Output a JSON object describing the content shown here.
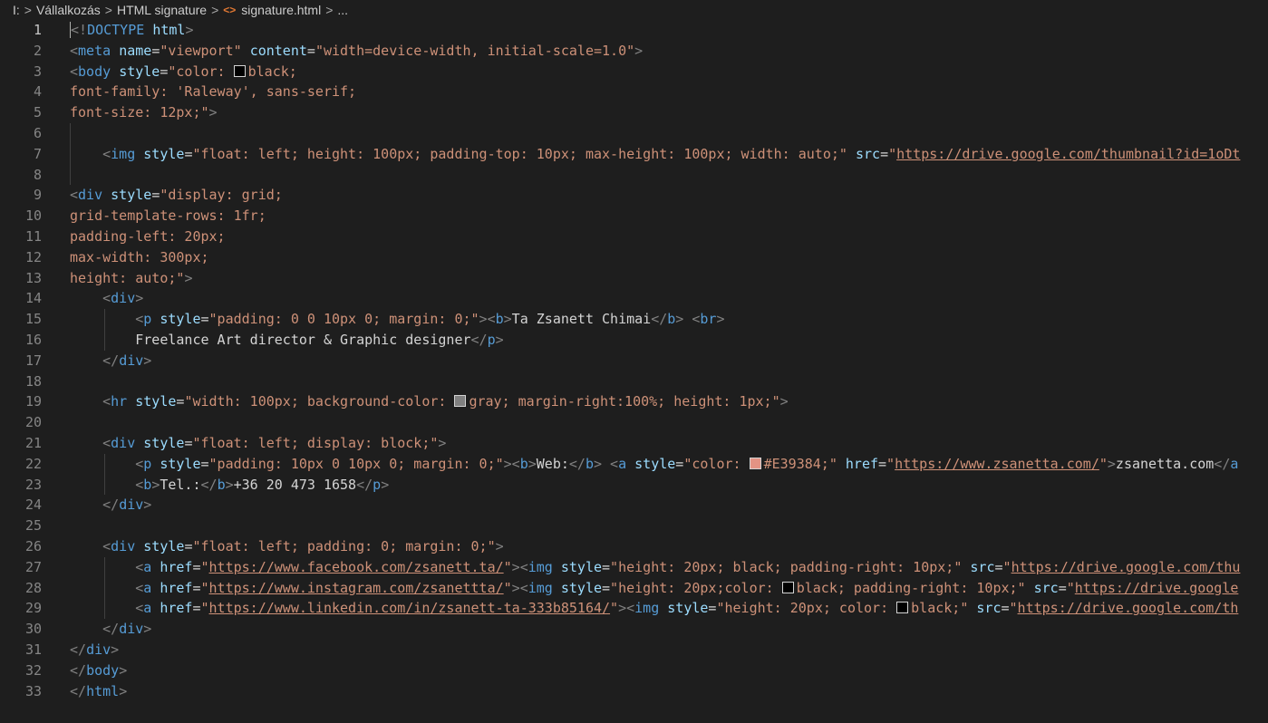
{
  "breadcrumb": {
    "drive": "I:",
    "folder": "Vállalkozás",
    "subfolder": "HTML signature",
    "file": "signature.html",
    "more": "..."
  },
  "icons": {
    "file": "html-file-icon",
    "separator": "chevron-right-icon"
  },
  "colors": {
    "background": "#1e1e1e",
    "tag": "#569cd6",
    "attr": "#9cdcfe",
    "string": "#ce9178",
    "text": "#d4d4d4",
    "accent_swatch": "#E39384"
  },
  "editor": {
    "active_line": 1,
    "lines": [
      {
        "n": "1",
        "t": [
          [
            "p",
            "<"
          ],
          [
            "p",
            "!"
          ],
          [
            "g",
            "DOCTYPE"
          ],
          [
            "x",
            " "
          ],
          [
            "a",
            "html"
          ],
          [
            "p",
            ">"
          ]
        ]
      },
      {
        "n": "2",
        "t": [
          [
            "p",
            "<"
          ],
          [
            "g",
            "meta"
          ],
          [
            "x",
            " "
          ],
          [
            "a",
            "name"
          ],
          [
            "x",
            "="
          ],
          [
            "s",
            "\"viewport\""
          ],
          [
            "x",
            " "
          ],
          [
            "a",
            "content"
          ],
          [
            "x",
            "="
          ],
          [
            "s",
            "\"width=device-width, initial-scale=1.0\""
          ],
          [
            "p",
            ">"
          ]
        ]
      },
      {
        "n": "3",
        "t": [
          [
            "p",
            "<"
          ],
          [
            "g",
            "body"
          ],
          [
            "x",
            " "
          ],
          [
            "a",
            "style"
          ],
          [
            "x",
            "="
          ],
          [
            "s",
            "\"color: "
          ],
          [
            "w",
            "#000000"
          ],
          [
            "s",
            "black;"
          ]
        ]
      },
      {
        "n": "4",
        "t": [
          [
            "s",
            "font-family: 'Raleway', sans-serif;"
          ]
        ]
      },
      {
        "n": "5",
        "t": [
          [
            "s",
            "font-size: 12px;\""
          ],
          [
            "p",
            ">"
          ]
        ]
      },
      {
        "n": "6",
        "t": []
      },
      {
        "n": "7",
        "t": [
          [
            "x",
            "    "
          ],
          [
            "p",
            "<"
          ],
          [
            "g",
            "img"
          ],
          [
            "x",
            " "
          ],
          [
            "a",
            "style"
          ],
          [
            "x",
            "="
          ],
          [
            "s",
            "\"float: left; height: 100px; padding-top: 10px; max-height: 100px; width: auto;\""
          ],
          [
            "x",
            " "
          ],
          [
            "a",
            "src"
          ],
          [
            "x",
            "="
          ],
          [
            "s",
            "\""
          ],
          [
            "u",
            "https://drive.google.com/thumbnail?id=1oDt"
          ]
        ]
      },
      {
        "n": "8",
        "t": []
      },
      {
        "n": "9",
        "t": [
          [
            "p",
            "<"
          ],
          [
            "g",
            "div"
          ],
          [
            "x",
            " "
          ],
          [
            "a",
            "style"
          ],
          [
            "x",
            "="
          ],
          [
            "s",
            "\"display: grid;"
          ]
        ]
      },
      {
        "n": "10",
        "t": [
          [
            "s",
            "grid-template-rows: 1fr;"
          ]
        ]
      },
      {
        "n": "11",
        "t": [
          [
            "s",
            "padding-left: 20px;"
          ]
        ]
      },
      {
        "n": "12",
        "t": [
          [
            "s",
            "max-width: 300px;"
          ]
        ]
      },
      {
        "n": "13",
        "t": [
          [
            "s",
            "height: auto;\""
          ],
          [
            "p",
            ">"
          ]
        ]
      },
      {
        "n": "14",
        "t": [
          [
            "x",
            "    "
          ],
          [
            "p",
            "<"
          ],
          [
            "g",
            "div"
          ],
          [
            "p",
            ">"
          ]
        ]
      },
      {
        "n": "15",
        "t": [
          [
            "x",
            "        "
          ],
          [
            "p",
            "<"
          ],
          [
            "g",
            "p"
          ],
          [
            "x",
            " "
          ],
          [
            "a",
            "style"
          ],
          [
            "x",
            "="
          ],
          [
            "s",
            "\"padding: 0 0 10px 0; margin: 0;\""
          ],
          [
            "p",
            ">"
          ],
          [
            "p",
            "<"
          ],
          [
            "g",
            "b"
          ],
          [
            "p",
            ">"
          ],
          [
            "x",
            "Ta Zsanett Chimai"
          ],
          [
            "p",
            "</"
          ],
          [
            "g",
            "b"
          ],
          [
            "p",
            ">"
          ],
          [
            "x",
            " "
          ],
          [
            "p",
            "<"
          ],
          [
            "g",
            "br"
          ],
          [
            "p",
            ">"
          ]
        ]
      },
      {
        "n": "16",
        "t": [
          [
            "x",
            "        Freelance Art director & Graphic designer"
          ],
          [
            "p",
            "</"
          ],
          [
            "g",
            "p"
          ],
          [
            "p",
            ">"
          ]
        ]
      },
      {
        "n": "17",
        "t": [
          [
            "x",
            "    "
          ],
          [
            "p",
            "</"
          ],
          [
            "g",
            "div"
          ],
          [
            "p",
            ">"
          ]
        ]
      },
      {
        "n": "18",
        "t": []
      },
      {
        "n": "19",
        "t": [
          [
            "x",
            "    "
          ],
          [
            "p",
            "<"
          ],
          [
            "g",
            "hr"
          ],
          [
            "x",
            " "
          ],
          [
            "a",
            "style"
          ],
          [
            "x",
            "="
          ],
          [
            "s",
            "\"width: 100px; background-color: "
          ],
          [
            "w",
            "#808080"
          ],
          [
            "s",
            "gray; margin-right:100%; height: 1px;\""
          ],
          [
            "p",
            ">"
          ]
        ]
      },
      {
        "n": "20",
        "t": []
      },
      {
        "n": "21",
        "t": [
          [
            "x",
            "    "
          ],
          [
            "p",
            "<"
          ],
          [
            "g",
            "div"
          ],
          [
            "x",
            " "
          ],
          [
            "a",
            "style"
          ],
          [
            "x",
            "="
          ],
          [
            "s",
            "\"float: left; display: block;\""
          ],
          [
            "p",
            ">"
          ]
        ]
      },
      {
        "n": "22",
        "t": [
          [
            "x",
            "        "
          ],
          [
            "p",
            "<"
          ],
          [
            "g",
            "p"
          ],
          [
            "x",
            " "
          ],
          [
            "a",
            "style"
          ],
          [
            "x",
            "="
          ],
          [
            "s",
            "\"padding: 10px 0 10px 0; margin: 0;\""
          ],
          [
            "p",
            ">"
          ],
          [
            "p",
            "<"
          ],
          [
            "g",
            "b"
          ],
          [
            "p",
            ">"
          ],
          [
            "x",
            "Web:"
          ],
          [
            "p",
            "</"
          ],
          [
            "g",
            "b"
          ],
          [
            "p",
            ">"
          ],
          [
            "x",
            " "
          ],
          [
            "p",
            "<"
          ],
          [
            "g",
            "a"
          ],
          [
            "x",
            " "
          ],
          [
            "a",
            "style"
          ],
          [
            "x",
            "="
          ],
          [
            "s",
            "\"color: "
          ],
          [
            "w",
            "#E39384"
          ],
          [
            "s",
            "#E39384;\""
          ],
          [
            "x",
            " "
          ],
          [
            "a",
            "href"
          ],
          [
            "x",
            "="
          ],
          [
            "s",
            "\""
          ],
          [
            "u",
            "https://www.zsanetta.com/"
          ],
          [
            "s",
            "\""
          ],
          [
            "p",
            ">"
          ],
          [
            "x",
            "zsanetta.com"
          ],
          [
            "p",
            "</"
          ],
          [
            "g",
            "a"
          ]
        ]
      },
      {
        "n": "23",
        "t": [
          [
            "x",
            "        "
          ],
          [
            "p",
            "<"
          ],
          [
            "g",
            "b"
          ],
          [
            "p",
            ">"
          ],
          [
            "x",
            "Tel.:"
          ],
          [
            "p",
            "</"
          ],
          [
            "g",
            "b"
          ],
          [
            "p",
            ">"
          ],
          [
            "x",
            "+36 20 473 1658"
          ],
          [
            "p",
            "</"
          ],
          [
            "g",
            "p"
          ],
          [
            "p",
            ">"
          ]
        ]
      },
      {
        "n": "24",
        "t": [
          [
            "x",
            "    "
          ],
          [
            "p",
            "</"
          ],
          [
            "g",
            "div"
          ],
          [
            "p",
            ">"
          ]
        ]
      },
      {
        "n": "25",
        "t": []
      },
      {
        "n": "26",
        "t": [
          [
            "x",
            "    "
          ],
          [
            "p",
            "<"
          ],
          [
            "g",
            "div"
          ],
          [
            "x",
            " "
          ],
          [
            "a",
            "style"
          ],
          [
            "x",
            "="
          ],
          [
            "s",
            "\"float: left; padding: 0; margin: 0;\""
          ],
          [
            "p",
            ">"
          ]
        ]
      },
      {
        "n": "27",
        "t": [
          [
            "x",
            "        "
          ],
          [
            "p",
            "<"
          ],
          [
            "g",
            "a"
          ],
          [
            "x",
            " "
          ],
          [
            "a",
            "href"
          ],
          [
            "x",
            "="
          ],
          [
            "s",
            "\""
          ],
          [
            "u",
            "https://www.facebook.com/zsanett.ta/"
          ],
          [
            "s",
            "\""
          ],
          [
            "p",
            ">"
          ],
          [
            "p",
            "<"
          ],
          [
            "g",
            "img"
          ],
          [
            "x",
            " "
          ],
          [
            "a",
            "style"
          ],
          [
            "x",
            "="
          ],
          [
            "s",
            "\"height: 20px; black; padding-right: 10px;\""
          ],
          [
            "x",
            " "
          ],
          [
            "a",
            "src"
          ],
          [
            "x",
            "="
          ],
          [
            "s",
            "\""
          ],
          [
            "u",
            "https://drive.google.com/thu"
          ]
        ]
      },
      {
        "n": "28",
        "t": [
          [
            "x",
            "        "
          ],
          [
            "p",
            "<"
          ],
          [
            "g",
            "a"
          ],
          [
            "x",
            " "
          ],
          [
            "a",
            "href"
          ],
          [
            "x",
            "="
          ],
          [
            "s",
            "\""
          ],
          [
            "u",
            "https://www.instagram.com/zsanettta/"
          ],
          [
            "s",
            "\""
          ],
          [
            "p",
            ">"
          ],
          [
            "p",
            "<"
          ],
          [
            "g",
            "img"
          ],
          [
            "x",
            " "
          ],
          [
            "a",
            "style"
          ],
          [
            "x",
            "="
          ],
          [
            "s",
            "\"height: 20px;color: "
          ],
          [
            "w",
            "#000000"
          ],
          [
            "s",
            "black; padding-right: 10px;\""
          ],
          [
            "x",
            " "
          ],
          [
            "a",
            "src"
          ],
          [
            "x",
            "="
          ],
          [
            "s",
            "\""
          ],
          [
            "u",
            "https://drive.google"
          ]
        ]
      },
      {
        "n": "29",
        "t": [
          [
            "x",
            "        "
          ],
          [
            "p",
            "<"
          ],
          [
            "g",
            "a"
          ],
          [
            "x",
            " "
          ],
          [
            "a",
            "href"
          ],
          [
            "x",
            "="
          ],
          [
            "s",
            "\""
          ],
          [
            "u",
            "https://www.linkedin.com/in/zsanett-ta-333b85164/"
          ],
          [
            "s",
            "\""
          ],
          [
            "p",
            ">"
          ],
          [
            "p",
            "<"
          ],
          [
            "g",
            "img"
          ],
          [
            "x",
            " "
          ],
          [
            "a",
            "style"
          ],
          [
            "x",
            "="
          ],
          [
            "s",
            "\"height: 20px; color: "
          ],
          [
            "w",
            "#000000"
          ],
          [
            "s",
            "black;\""
          ],
          [
            "x",
            " "
          ],
          [
            "a",
            "src"
          ],
          [
            "x",
            "="
          ],
          [
            "s",
            "\""
          ],
          [
            "u",
            "https://drive.google.com/th"
          ]
        ]
      },
      {
        "n": "30",
        "t": [
          [
            "x",
            "    "
          ],
          [
            "p",
            "</"
          ],
          [
            "g",
            "div"
          ],
          [
            "p",
            ">"
          ]
        ]
      },
      {
        "n": "31",
        "t": [
          [
            "p",
            "</"
          ],
          [
            "g",
            "div"
          ],
          [
            "p",
            ">"
          ]
        ]
      },
      {
        "n": "32",
        "t": [
          [
            "p",
            "</"
          ],
          [
            "g",
            "body"
          ],
          [
            "p",
            ">"
          ]
        ]
      },
      {
        "n": "33",
        "t": [
          [
            "p",
            "</"
          ],
          [
            "g",
            "html"
          ],
          [
            "p",
            ">"
          ]
        ]
      }
    ]
  }
}
